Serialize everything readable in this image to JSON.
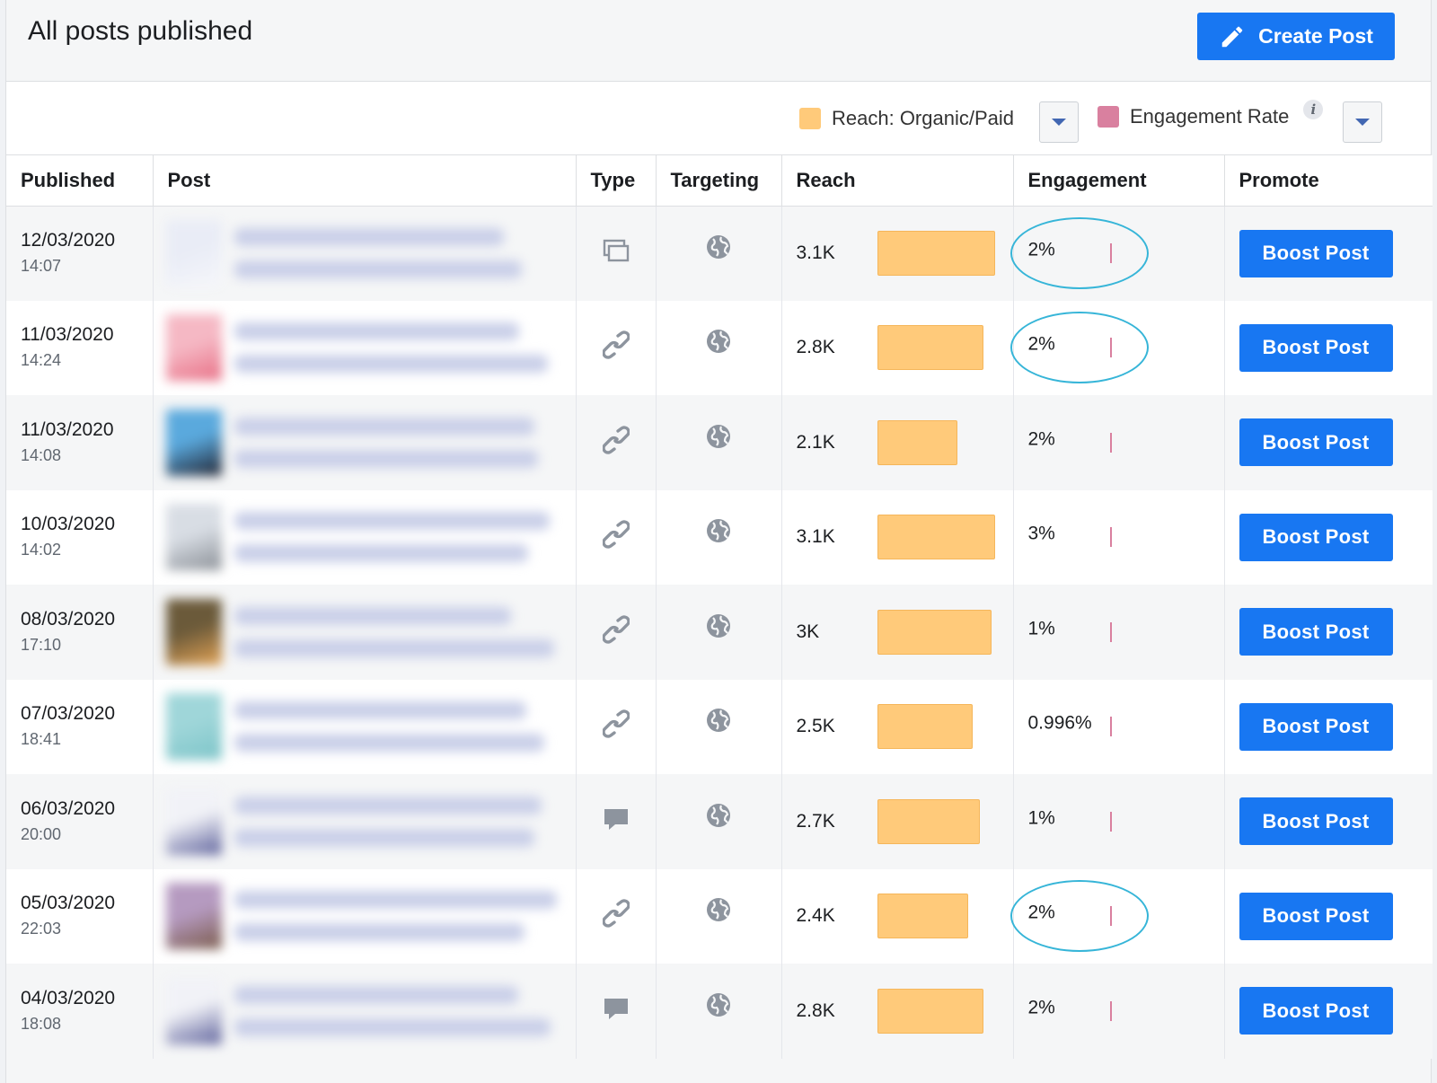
{
  "header": {
    "title": "All posts published",
    "create_label": "Create Post"
  },
  "legend": {
    "reach_label": "Reach: Organic/Paid",
    "reach_color": "#ffca7a",
    "engagement_label": "Engagement Rate",
    "engagement_color": "#d9809f",
    "info_glyph": "i"
  },
  "columns": {
    "published": "Published",
    "post": "Post",
    "type": "Type",
    "targeting": "Targeting",
    "reach": "Reach",
    "engagement": "Engagement",
    "promote": "Promote"
  },
  "boost_label": "Boost Post",
  "reach_max_value": 3.3,
  "rows": [
    {
      "date": "12/03/2020",
      "time": "14:07",
      "type_icon": "album-icon",
      "reach": "3.1K",
      "reach_value": 3.1,
      "engagement": "2%",
      "highlighted": true
    },
    {
      "date": "11/03/2020",
      "time": "14:24",
      "type_icon": "link-icon",
      "reach": "2.8K",
      "reach_value": 2.8,
      "engagement": "2%",
      "highlighted": true
    },
    {
      "date": "11/03/2020",
      "time": "14:08",
      "type_icon": "link-icon",
      "reach": "2.1K",
      "reach_value": 2.1,
      "engagement": "2%",
      "highlighted": false
    },
    {
      "date": "10/03/2020",
      "time": "14:02",
      "type_icon": "link-icon",
      "reach": "3.1K",
      "reach_value": 3.1,
      "engagement": "3%",
      "highlighted": false
    },
    {
      "date": "08/03/2020",
      "time": "17:10",
      "type_icon": "link-icon",
      "reach": "3K",
      "reach_value": 3.0,
      "engagement": "1%",
      "highlighted": false
    },
    {
      "date": "07/03/2020",
      "time": "18:41",
      "type_icon": "link-icon",
      "reach": "2.5K",
      "reach_value": 2.5,
      "engagement": "0.996%",
      "highlighted": false
    },
    {
      "date": "06/03/2020",
      "time": "20:00",
      "type_icon": "status-icon",
      "reach": "2.7K",
      "reach_value": 2.7,
      "engagement": "1%",
      "highlighted": false
    },
    {
      "date": "05/03/2020",
      "time": "22:03",
      "type_icon": "link-icon",
      "reach": "2.4K",
      "reach_value": 2.4,
      "engagement": "2%",
      "highlighted": true
    },
    {
      "date": "04/03/2020",
      "time": "18:08",
      "type_icon": "status-icon",
      "reach": "2.8K",
      "reach_value": 2.8,
      "engagement": "2%",
      "highlighted": false
    }
  ]
}
